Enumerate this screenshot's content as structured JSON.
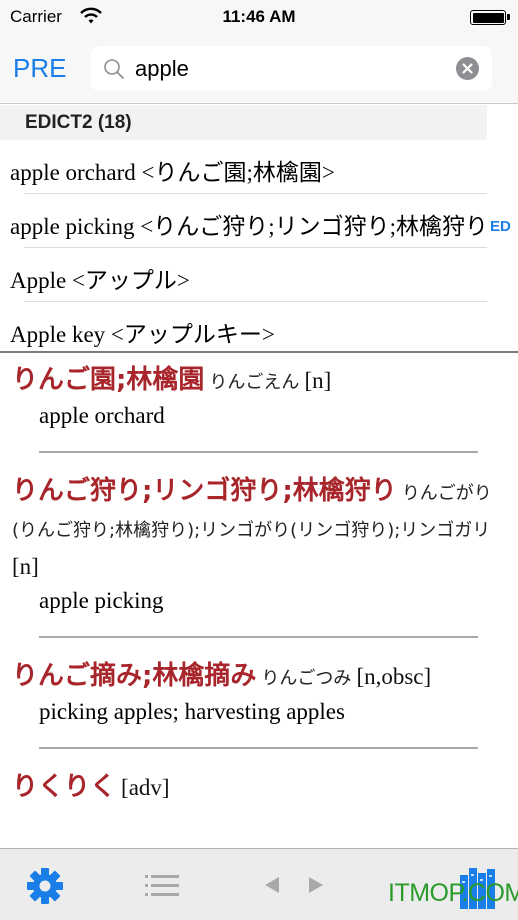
{
  "status_bar": {
    "carrier": "Carrier",
    "time": "11:46 AM",
    "battery_level": 1.0
  },
  "nav": {
    "pre_label": "PRE",
    "search": {
      "value": "apple",
      "icon": "search-icon",
      "clear_icon": "clear-icon"
    }
  },
  "section": {
    "title": "EDICT2 (18)"
  },
  "results": [
    {
      "label": "apple orchard <りんご園;林檎園>"
    },
    {
      "label": "apple picking <りんご狩り;リンゴ狩り;林檎狩り>"
    },
    {
      "label": "Apple <アップル>"
    },
    {
      "label": "Apple key <アップルキー>"
    }
  ],
  "index_label": "ED",
  "entries": [
    {
      "headword": "りんご園;林檎園",
      "reading": "りんごえん",
      "pos": "[n]",
      "gloss": "apple orchard"
    },
    {
      "headword": "りんご狩り;リンゴ狩り;林檎狩り",
      "reading": "りんごがり(りんご狩り;林檎狩り);リンゴがり(リンゴ狩り);リンゴガリ",
      "pos": "[n]",
      "gloss": "apple picking"
    },
    {
      "headword": "りんご摘み;林檎摘み",
      "reading": "りんごつみ",
      "pos": "[n,obsc]",
      "gloss": "picking apples; harvesting apples"
    },
    {
      "headword": "りくりく",
      "reading": "",
      "pos": "[adv]",
      "gloss": ""
    }
  ],
  "toolbar": {
    "settings_icon": "gear-icon",
    "list_icon": "list-icon",
    "back_icon": "back-arrow-icon",
    "forward_icon": "forward-arrow-icon",
    "library_icon": "library-icon",
    "watermark": "ITMOP.COM"
  },
  "colors": {
    "accent": "#1a7ee8",
    "headword": "#a8262b",
    "watermark": "#2a9b2a"
  }
}
